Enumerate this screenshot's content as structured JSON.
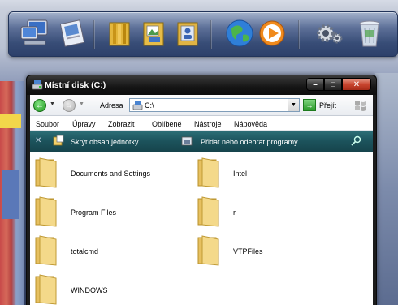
{
  "dock": {
    "icons": [
      "computer-icon",
      "documents-icon",
      "library-icon",
      "image-folder-icon",
      "contacts-folder-icon",
      "globe-icon",
      "media-player-icon",
      "gear-icon",
      "recycle-bin-icon"
    ]
  },
  "window": {
    "title": "Místní disk (C:)",
    "caption_buttons": {
      "minimize": "–",
      "maximize": "□",
      "close": "✕"
    }
  },
  "address_bar": {
    "label": "Adresa",
    "value": "C:\\",
    "go_label": "Přejít"
  },
  "menu": [
    "Soubor",
    "Úpravy",
    "Zobrazit",
    "Oblíbené",
    "Nástroje",
    "Nápověda"
  ],
  "tasks": {
    "hide": "Skrýt obsah jednotky",
    "add_remove": "Přidat nebo odebrat programy"
  },
  "files": [
    {
      "name": "Documents and Settings"
    },
    {
      "name": "Intel"
    },
    {
      "name": "Program Files"
    },
    {
      "name": "r"
    },
    {
      "name": "totalcmd"
    },
    {
      "name": "VTPFiles"
    },
    {
      "name": "WINDOWS"
    }
  ],
  "colors": {
    "task_pane": "#1c535c",
    "folder": "#f2d27a",
    "title_bar": "#151515"
  }
}
